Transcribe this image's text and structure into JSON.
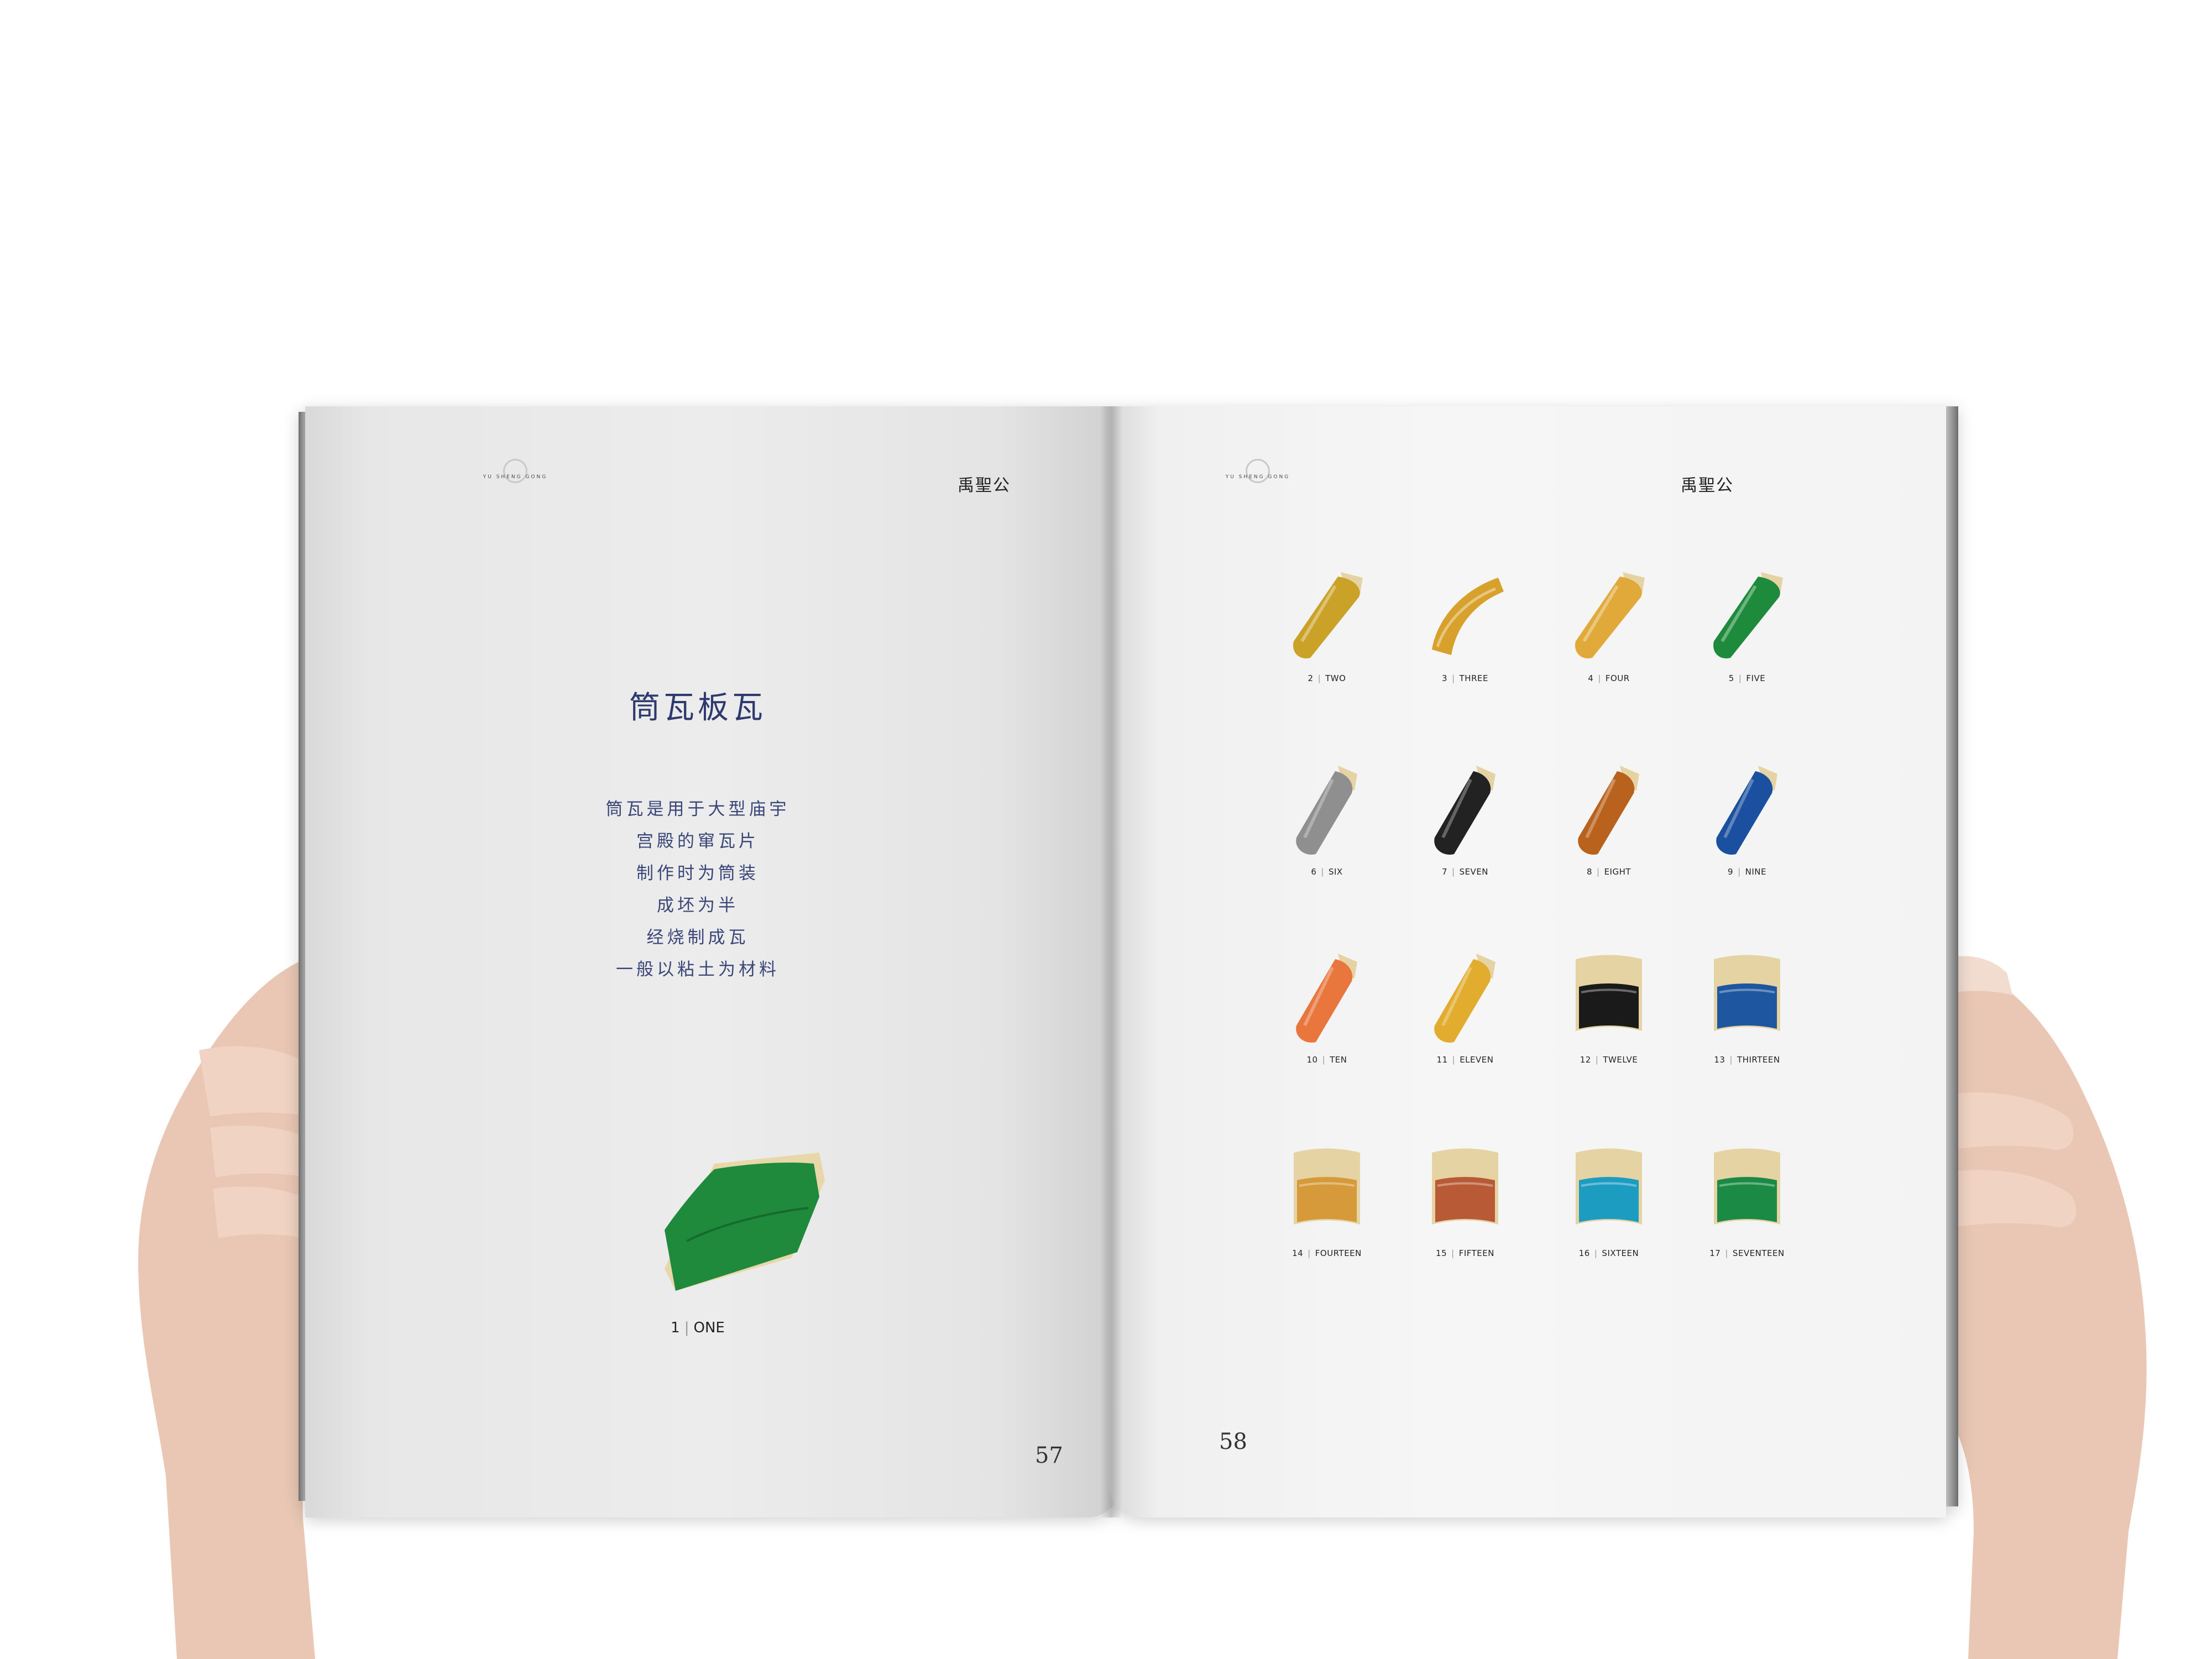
{
  "brand": {
    "latin": "YU SHENG GONG",
    "name": "禹聖公"
  },
  "left_page": {
    "title": "筒瓦板瓦",
    "poem": [
      "筒瓦是用于大型庙宇",
      "宫殿的窜瓦片",
      "制作时为筒装",
      "成坯为半",
      "经烧制成瓦",
      "一般以粘土为材料"
    ],
    "feature": {
      "number": "1",
      "word": "ONE",
      "color": "#1f8a3c"
    },
    "page_number": "57"
  },
  "right_page": {
    "page_number": "58",
    "items": [
      {
        "number": "2",
        "word": "TWO",
        "color": "#c9a227",
        "shape": "flat"
      },
      {
        "number": "3",
        "word": "THREE",
        "color": "#d7a12c",
        "shape": "curve"
      },
      {
        "number": "4",
        "word": "FOUR",
        "color": "#e0a93a",
        "shape": "flat"
      },
      {
        "number": "5",
        "word": "FIVE",
        "color": "#1e8a3b",
        "shape": "flat"
      },
      {
        "number": "6",
        "word": "SIX",
        "color": "#8f8f8f",
        "shape": "tube"
      },
      {
        "number": "7",
        "word": "SEVEN",
        "color": "#222222",
        "shape": "tube"
      },
      {
        "number": "8",
        "word": "EIGHT",
        "color": "#b8621d",
        "shape": "tube"
      },
      {
        "number": "9",
        "word": "NINE",
        "color": "#1b4fa0",
        "shape": "tube"
      },
      {
        "number": "10",
        "word": "TEN",
        "color": "#e8763d",
        "shape": "tube"
      },
      {
        "number": "11",
        "word": "ELEVEN",
        "color": "#e2ac2f",
        "shape": "tube"
      },
      {
        "number": "12",
        "word": "TWELVE",
        "color": "#1a1a1a",
        "shape": "plate"
      },
      {
        "number": "13",
        "word": "THIRTEEN",
        "color": "#1e56a0",
        "shape": "plate"
      },
      {
        "number": "14",
        "word": "FOURTEEN",
        "color": "#d69a3a",
        "shape": "plate"
      },
      {
        "number": "15",
        "word": "FIFTEEN",
        "color": "#b85a35",
        "shape": "plate"
      },
      {
        "number": "16",
        "word": "SIXTEEN",
        "color": "#1c9cc0",
        "shape": "plate"
      },
      {
        "number": "17",
        "word": "SEVENTEEN",
        "color": "#1b8a44",
        "shape": "plate"
      }
    ]
  }
}
